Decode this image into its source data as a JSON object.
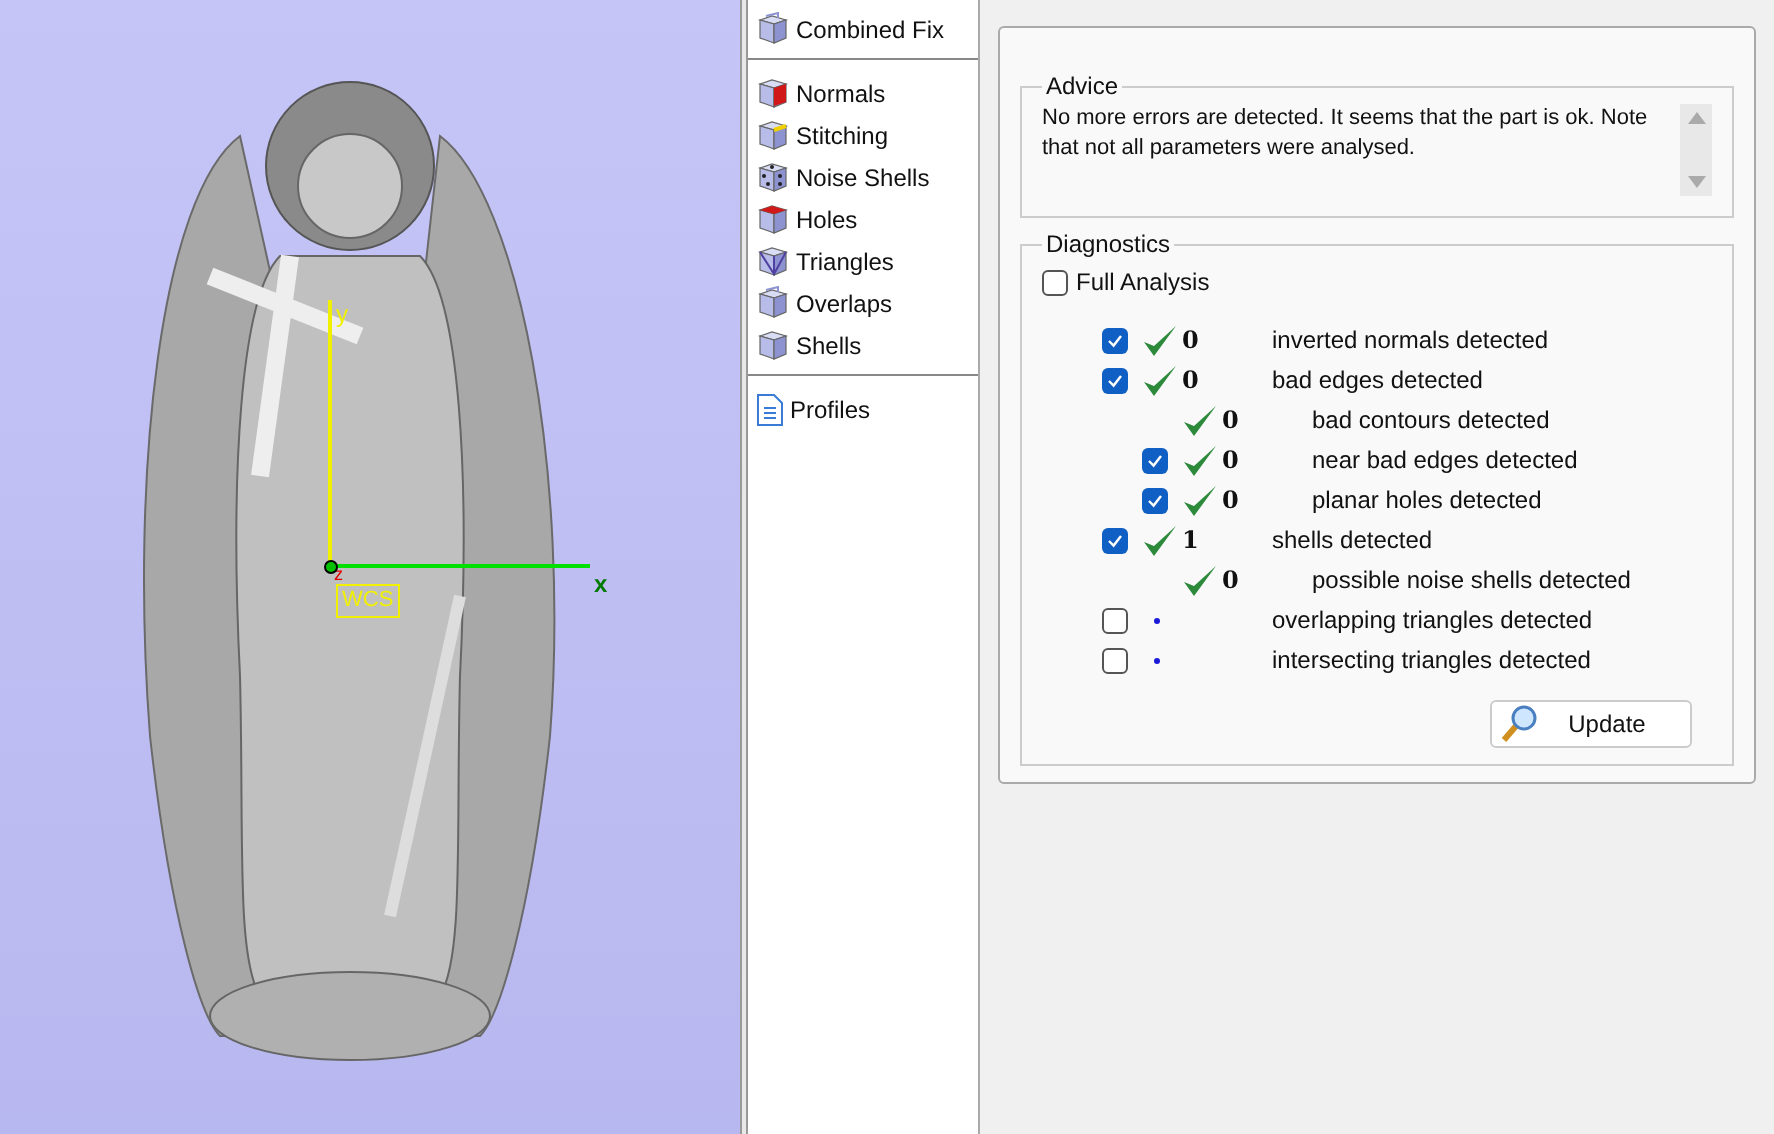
{
  "viewport": {
    "axis_x": "x",
    "axis_y": "y",
    "axis_z": "z",
    "wcs": "WCS"
  },
  "sidebar": {
    "groups": [
      [
        {
          "label": "Combined Fix"
        }
      ],
      [
        {
          "label": "Normals"
        },
        {
          "label": "Stitching"
        },
        {
          "label": "Noise Shells"
        },
        {
          "label": "Holes"
        },
        {
          "label": "Triangles"
        },
        {
          "label": "Overlaps"
        },
        {
          "label": "Shells"
        }
      ],
      [
        {
          "label": "Profiles"
        }
      ]
    ]
  },
  "advice": {
    "title": "Advice",
    "text": "No more errors are detected. It seems that the part is ok. Note that not all parameters were analysed."
  },
  "diagnostics": {
    "title": "Diagnostics",
    "full_analysis": {
      "label": "Full Analysis",
      "checked": false
    },
    "rows": [
      {
        "kind": "checkbox",
        "checked": true,
        "passed": true,
        "count": "0",
        "label": "inverted normals detected"
      },
      {
        "kind": "checkbox",
        "checked": true,
        "passed": true,
        "count": "0",
        "label": "bad edges detected",
        "children": [
          {
            "kind": "plain",
            "passed": true,
            "count": "0",
            "label": "bad contours detected"
          },
          {
            "kind": "checkbox",
            "checked": true,
            "passed": true,
            "count": "0",
            "label": "near bad edges detected"
          },
          {
            "kind": "checkbox",
            "checked": true,
            "passed": true,
            "count": "0",
            "label": "planar holes detected"
          }
        ]
      },
      {
        "kind": "checkbox",
        "checked": true,
        "passed": true,
        "count": "1",
        "label": "shells detected",
        "children": [
          {
            "kind": "plain",
            "passed": true,
            "count": "0",
            "label": "possible noise shells detected"
          }
        ]
      },
      {
        "kind": "checkbox",
        "checked": false,
        "passed": false,
        "label": "overlapping triangles detected"
      },
      {
        "kind": "checkbox",
        "checked": false,
        "passed": false,
        "label": "intersecting triangles detected"
      }
    ],
    "update_button": "Update"
  }
}
